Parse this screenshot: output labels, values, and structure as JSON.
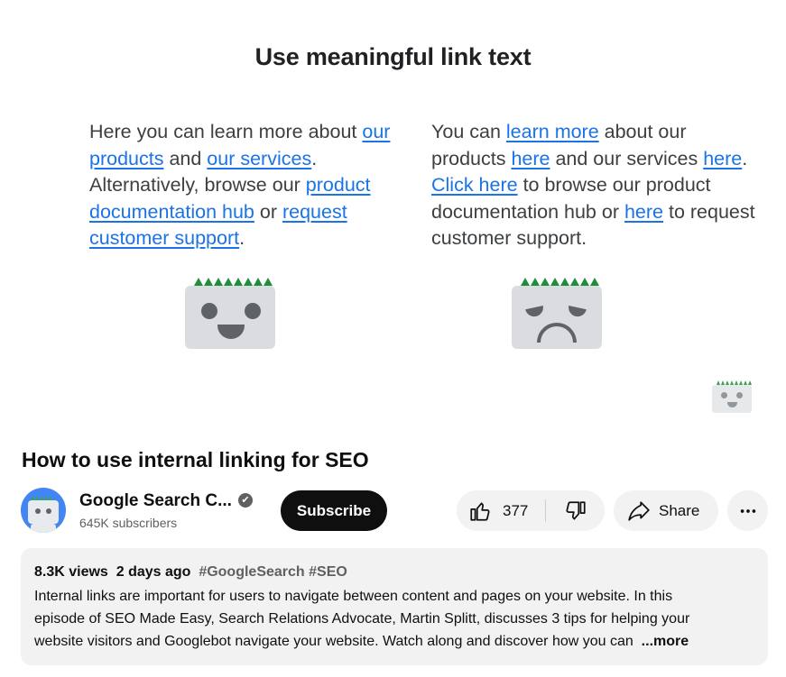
{
  "slide": {
    "title": "Use meaningful link text",
    "good_example": {
      "t1": "Here you can learn more about ",
      "l1": "our products",
      "t2": " and ",
      "l2": "our services",
      "t3": ". Alternatively, browse our ",
      "l3": "product documentation hub",
      "t4": " or ",
      "l4": "request customer support",
      "t5": "."
    },
    "bad_example": {
      "t1": "You can ",
      "l1": "learn more",
      "t2": " about our products ",
      "l2": "here",
      "t3": " and our services ",
      "l3": "here",
      "t4": ". ",
      "l4": "Click here",
      "t5": " to browse our product documentation hub or ",
      "l5": "here",
      "t6": " to request customer support."
    },
    "colors": {
      "link": "#1a73e8",
      "spikes": "#1e8e3e",
      "robot": "#dadce0"
    }
  },
  "video": {
    "title": "How to use internal linking for SEO",
    "channel": {
      "name": "Google Search C...",
      "verified_glyph": "✔",
      "subscribers": "645K subscribers"
    },
    "subscribe_label": "Subscribe",
    "like_count": "377",
    "share_label": "Share",
    "description": {
      "views": "8.3K views",
      "age": "2 days ago",
      "hashtags": "#GoogleSearch #SEO",
      "line1": "Internal links are important for users to navigate between content and pages on your website. In this",
      "line2": "episode of SEO Made Easy, Search Relations Advocate, Martin Splitt, discusses 3 tips for helping your",
      "line3": "website visitors and Googlebot navigate your website. Watch along and discover how you can",
      "more_label": "...more"
    }
  },
  "icons": {
    "like": "thumbs-up-icon",
    "dislike": "thumbs-down-icon",
    "share": "share-arrow-icon",
    "more": "more-horizontal-icon"
  }
}
